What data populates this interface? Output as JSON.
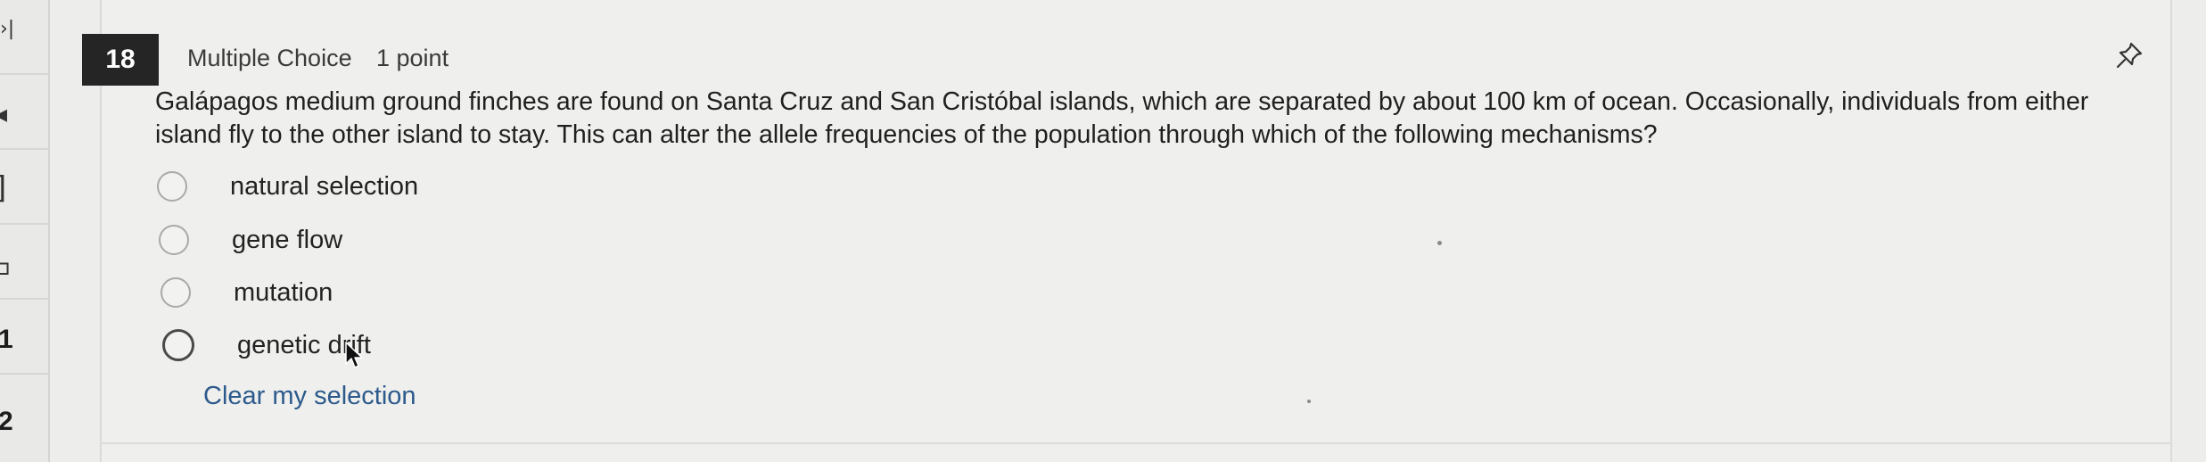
{
  "sidebar": {
    "rows": [
      {
        "glyph": "›|"
      },
      {
        "glyph": "◂"
      },
      {
        "glyph": "]"
      },
      {
        "glyph": "⊐"
      },
      {
        "number": "1"
      },
      {
        "number": "2"
      }
    ]
  },
  "question": {
    "number": "18",
    "type": "Multiple Choice",
    "points": "1 point",
    "text": "Galápagos medium ground finches are found on Santa Cruz and San Cristóbal islands, which are separated by about 100 km of ocean. Occasionally, individuals from either island fly to the other island to stay. This can alter the allele frequencies of the population through which of the following mechanisms?",
    "options": [
      {
        "label": "natural selection"
      },
      {
        "label": "gene flow"
      },
      {
        "label": "mutation"
      },
      {
        "label": "genetic drift"
      }
    ],
    "clear_label": "Clear my selection"
  },
  "icons": {
    "pin": "pushpin-icon",
    "cursor": "mouse-pointer-icon"
  }
}
